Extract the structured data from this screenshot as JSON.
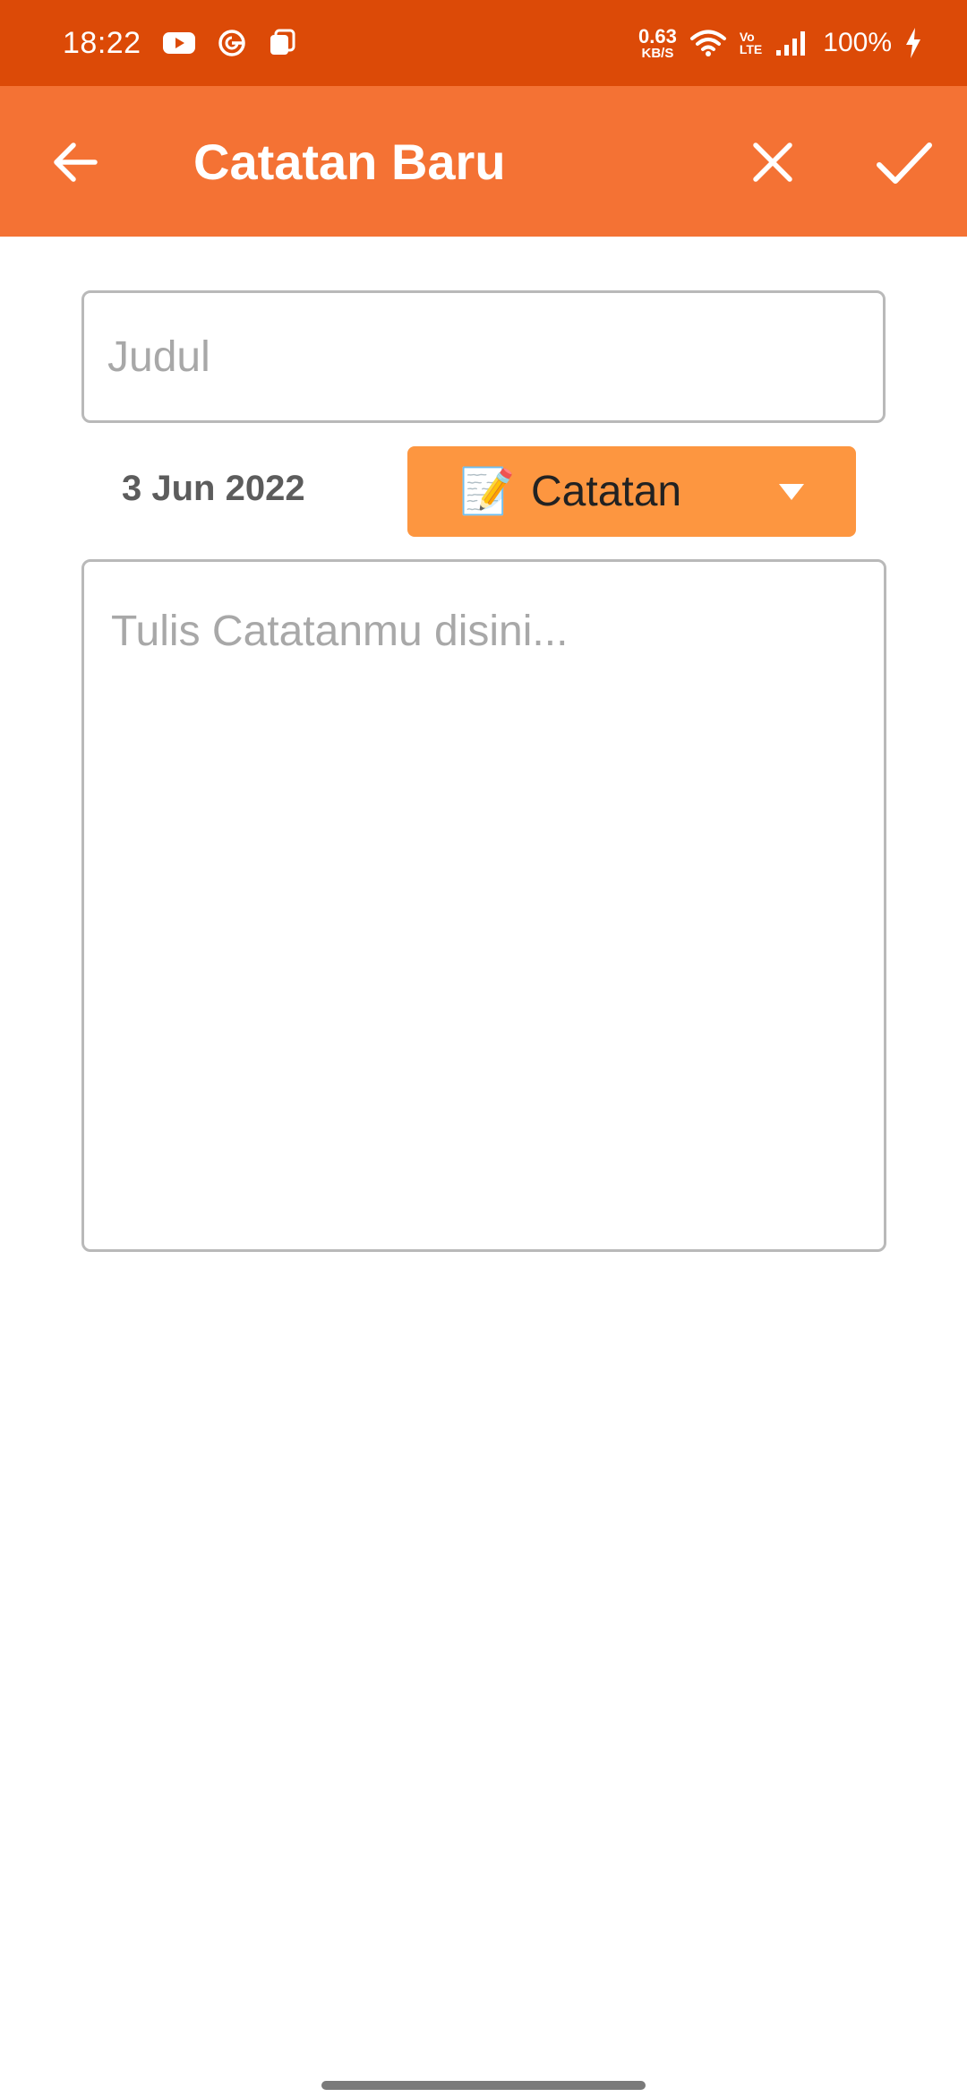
{
  "status_bar": {
    "time": "18:22",
    "net_speed_value": "0.63",
    "net_speed_unit": "KB/S",
    "volte_top": "Vo",
    "volte_bottom": "LTE",
    "battery": "100%"
  },
  "app_bar": {
    "title": "Catatan Baru",
    "background": "#f47234"
  },
  "form": {
    "title_placeholder": "Judul",
    "date": "3 Jun 2022",
    "category": {
      "emoji": "📝",
      "selected": "Catatan",
      "color": "#fd9640"
    },
    "note_placeholder": "Tulis Catatanmu disini..."
  },
  "icons": {
    "status": [
      "youtube-icon",
      "g-icon",
      "app-icon",
      "wifi-icon",
      "signal-icon",
      "charging-icon"
    ],
    "app_bar": [
      "arrow-left-icon",
      "close-icon",
      "check-icon"
    ],
    "dropdown": "caret-down-icon"
  }
}
